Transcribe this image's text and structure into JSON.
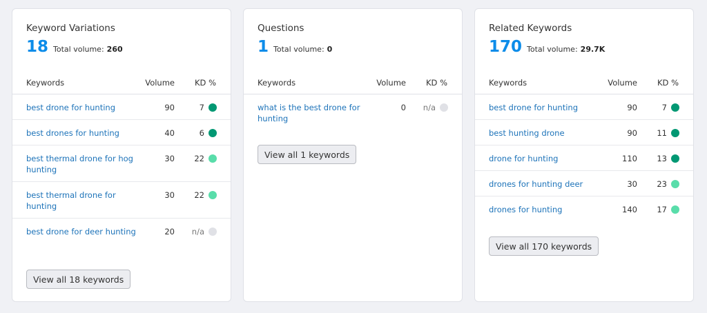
{
  "colors": {
    "accent": "#0c8ce9",
    "link": "#1d73b9",
    "kd_dark": "#029873",
    "kd_light": "#59ddaa",
    "kd_na": "#e0e1e6"
  },
  "headers": {
    "keywords": "Keywords",
    "volume": "Volume",
    "kd": "KD %"
  },
  "cards": [
    {
      "title": "Keyword Variations",
      "count": "18",
      "total_volume_label": "Total volume:",
      "total_volume": "260",
      "rows": [
        {
          "keyword": "best drone for hunting",
          "volume": "90",
          "kd": "7",
          "kd_color": "kd_dark"
        },
        {
          "keyword": "best drones for hunting",
          "volume": "40",
          "kd": "6",
          "kd_color": "kd_dark"
        },
        {
          "keyword": "best thermal drone for hog hunting",
          "volume": "30",
          "kd": "22",
          "kd_color": "kd_light"
        },
        {
          "keyword": "best thermal drone for hunting",
          "volume": "30",
          "kd": "22",
          "kd_color": "kd_light"
        },
        {
          "keyword": "best drone for deer hunting",
          "volume": "20",
          "kd": "n/a",
          "kd_color": "kd_na"
        }
      ],
      "view_all_label": "View all 18 keywords"
    },
    {
      "title": "Questions",
      "count": "1",
      "total_volume_label": "Total volume:",
      "total_volume": "0",
      "rows": [
        {
          "keyword": "what is the best drone for hunting",
          "volume": "0",
          "kd": "n/a",
          "kd_color": "kd_na"
        }
      ],
      "view_all_label": "View all 1 keywords"
    },
    {
      "title": "Related Keywords",
      "count": "170",
      "total_volume_label": "Total volume:",
      "total_volume": "29.7K",
      "rows": [
        {
          "keyword": "best drone for hunting",
          "volume": "90",
          "kd": "7",
          "kd_color": "kd_dark"
        },
        {
          "keyword": "best hunting drone",
          "volume": "90",
          "kd": "11",
          "kd_color": "kd_dark"
        },
        {
          "keyword": "drone for hunting",
          "volume": "110",
          "kd": "13",
          "kd_color": "kd_dark"
        },
        {
          "keyword": "drones for hunting deer",
          "volume": "30",
          "kd": "23",
          "kd_color": "kd_light"
        },
        {
          "keyword": "drones for hunting",
          "volume": "140",
          "kd": "17",
          "kd_color": "kd_light"
        }
      ],
      "view_all_label": "View all 170 keywords"
    }
  ]
}
